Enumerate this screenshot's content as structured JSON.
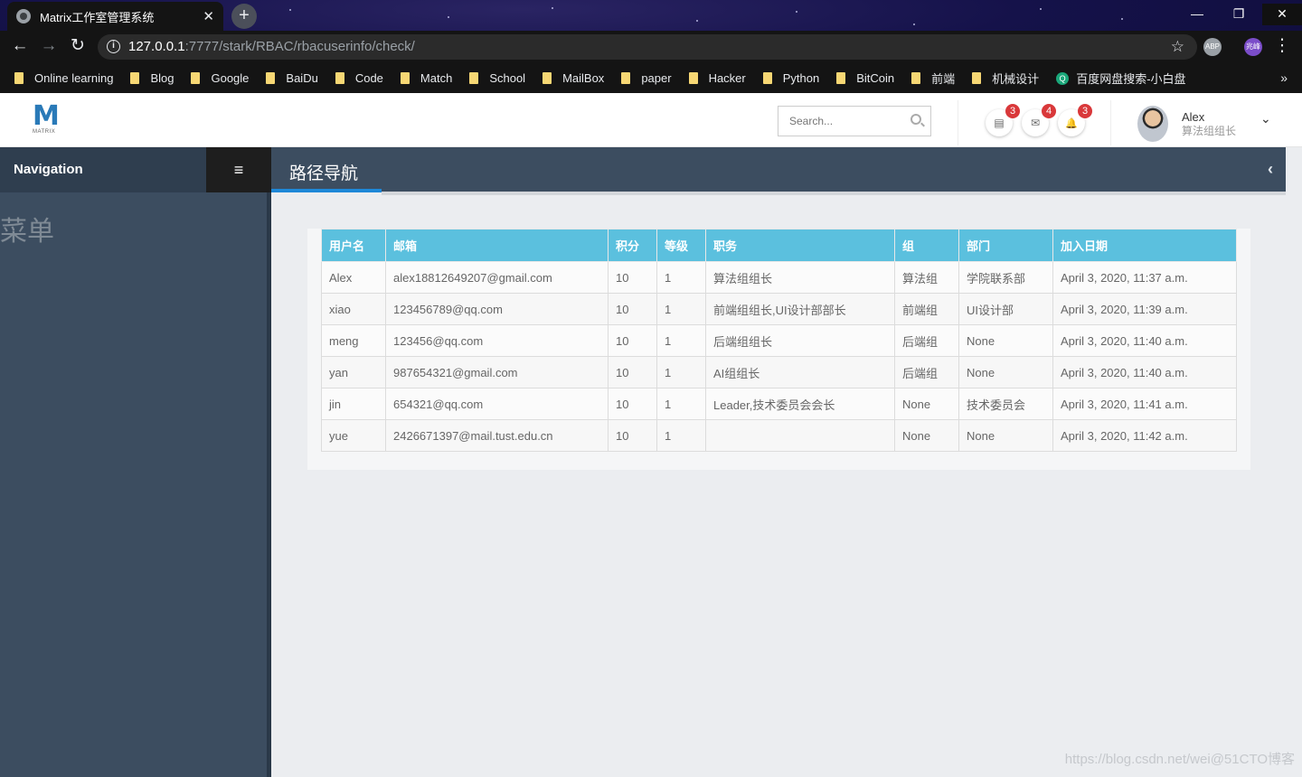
{
  "browser": {
    "tab_title": "Matrix工作室管理系统",
    "tab_close": "✕",
    "new_tab": "+",
    "url_host": "127.0.0.1",
    "url_path": ":7777/stark/RBAC/rbacuserinfo/check/",
    "window_controls": {
      "minimize": "—",
      "maximize": "❐",
      "close": "✕"
    },
    "nav": {
      "back": "←",
      "forward": "→",
      "reload": "↻"
    },
    "extensions": [
      {
        "label": "ABP",
        "color": "#9aa0a6"
      },
      {
        "label": "兆峰",
        "color": "#7b4dc9"
      }
    ],
    "more_menu": "⋮",
    "bookmarks": [
      "Online learning",
      "Blog",
      "Google",
      "BaiDu",
      "Code",
      "Match",
      "School",
      "MailBox",
      "paper",
      "Hacker",
      "Python",
      "BitCoin",
      "前端",
      "机械设计"
    ],
    "bookmark_search": "百度网盘搜索-小白盘",
    "bookmarks_more": "»"
  },
  "header": {
    "logo_text": "M",
    "logo_sub": "MATRIX",
    "search_placeholder": "Search...",
    "notifications": [
      {
        "icon": "inbox-icon",
        "glyph": "▤",
        "count": "3"
      },
      {
        "icon": "mail-icon",
        "glyph": "✉",
        "count": "4"
      },
      {
        "icon": "bell-icon",
        "glyph": "🔔",
        "count": "3"
      }
    ],
    "user": {
      "name": "Alex",
      "role": "算法组组长",
      "caret": "⌄"
    }
  },
  "sidebar": {
    "title": "Navigation",
    "toggle": "≡",
    "menu_label": "菜单"
  },
  "main": {
    "breadcrumb_title": "路径导航",
    "back_glyph": "‹"
  },
  "table": {
    "headers": [
      "用户名",
      "邮箱",
      "积分",
      "等级",
      "职务",
      "组",
      "部门",
      "加入日期"
    ],
    "rows": [
      [
        "Alex",
        "alex18812649207@gmail.com",
        "10",
        "1",
        "算法组组长",
        "算法组",
        "学院联系部",
        "April 3, 2020, 11:37 a.m."
      ],
      [
        "xiao",
        "123456789@qq.com",
        "10",
        "1",
        "前端组组长,UI设计部部长",
        "前端组",
        "UI设计部",
        "April 3, 2020, 11:39 a.m."
      ],
      [
        "meng",
        "123456@qq.com",
        "10",
        "1",
        "后端组组长",
        "后端组",
        "None",
        "April 3, 2020, 11:40 a.m."
      ],
      [
        "yan",
        "987654321@gmail.com",
        "10",
        "1",
        "AI组组长",
        "后端组",
        "None",
        "April 3, 2020, 11:40 a.m."
      ],
      [
        "jin",
        "654321@qq.com",
        "10",
        "1",
        "Leader,技术委员会会长",
        "None",
        "技术委员会",
        "April 3, 2020, 11:41 a.m."
      ],
      [
        "yue",
        "2426671397@mail.tust.edu.cn",
        "10",
        "1",
        "",
        "None",
        "None",
        "April 3, 2020, 11:42 a.m."
      ]
    ]
  },
  "watermark": "https://blog.csdn.net/wei@51CTO博客",
  "colors": {
    "sidebar": "#3c4d60",
    "table_header": "#5bc0de",
    "accent": "#1e88d8",
    "badge": "#d9383a"
  }
}
